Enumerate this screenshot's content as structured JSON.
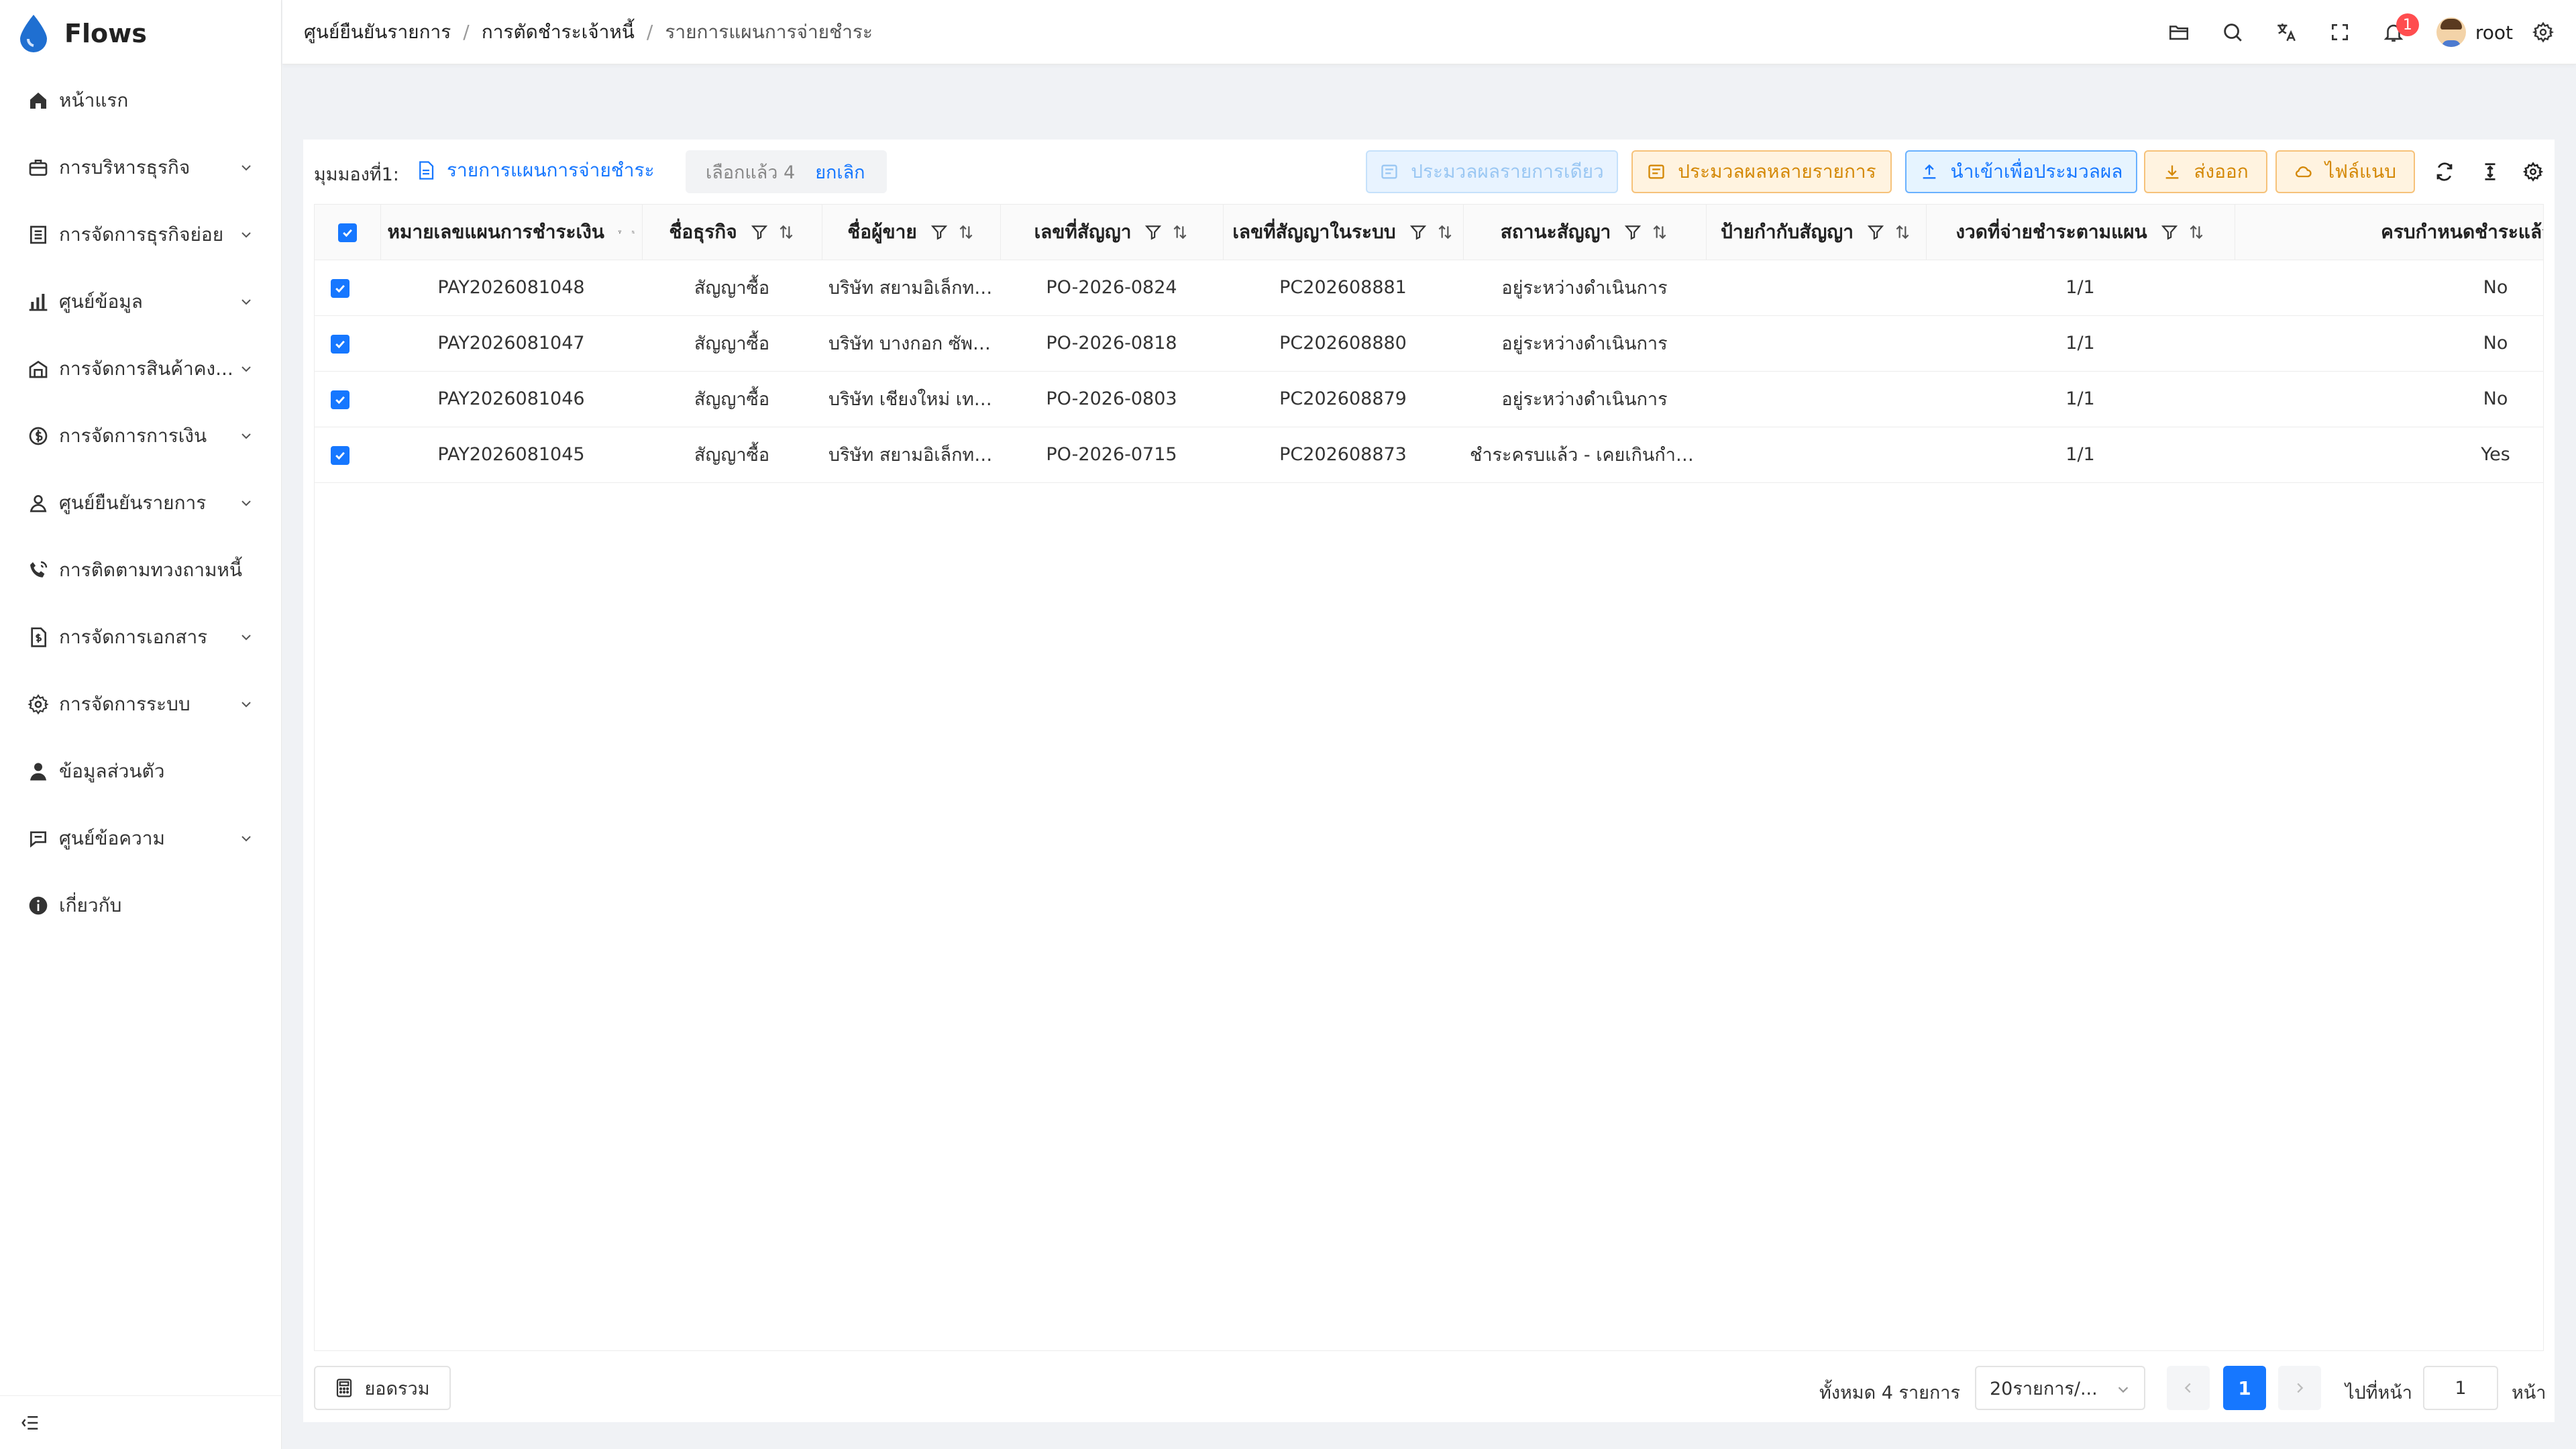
{
  "app": {
    "name": "Flows"
  },
  "sidebar": {
    "items": [
      {
        "label": "หน้าแรก",
        "icon": "home-icon",
        "has_children": false
      },
      {
        "label": "การบริหารธุรกิจ",
        "icon": "briefcase-icon",
        "has_children": true
      },
      {
        "label": "การจัดการธุรกิจย่อย",
        "icon": "building-icon",
        "has_children": true
      },
      {
        "label": "ศูนย์ข้อมูล",
        "icon": "bar-chart-icon",
        "has_children": true
      },
      {
        "label": "การจัดการสินค้าคง...",
        "icon": "warehouse-icon",
        "has_children": true
      },
      {
        "label": "การจัดการการเงิน",
        "icon": "dollar-circle-icon",
        "has_children": true
      },
      {
        "label": "ศูนย์ยืนยันรายการ",
        "icon": "user-check-icon",
        "has_children": true
      },
      {
        "label": "การติดตามทวงถามหนี้",
        "icon": "phone-call-icon",
        "has_children": false
      },
      {
        "label": "การจัดการเอกสาร",
        "icon": "document-dollar-icon",
        "has_children": true
      },
      {
        "label": "การจัดการระบบ",
        "icon": "gear-icon",
        "has_children": true
      },
      {
        "label": "ข้อมูลส่วนตัว",
        "icon": "person-icon",
        "has_children": false
      },
      {
        "label": "ศูนย์ข้อความ",
        "icon": "message-icon",
        "has_children": true
      },
      {
        "label": "เกี่ยวกับ",
        "icon": "info-icon",
        "has_children": false
      }
    ]
  },
  "header": {
    "breadcrumb": [
      "ศูนย์ยืนยันรายการ",
      "การตัดชำระเจ้าหนี้",
      "รายการแผนการจ่ายชำระ"
    ],
    "notification_count": "1",
    "username": "root"
  },
  "toolbar": {
    "view_label": "มุมมองที่1:",
    "view_name": "รายการแผนการจ่ายชำระ",
    "selected_text": "เลือกแล้ว 4",
    "cancel_label": "ยกเลิก",
    "btn_single": "ประมวลผลรายการเดียว",
    "btn_multi": "ประมวลผลหลายรายการ",
    "btn_import": "นำเข้าเพื่อประมวลผล",
    "btn_export": "ส่งออก",
    "btn_attach": "ไฟล์แนบ"
  },
  "table": {
    "columns": [
      "หมายเลขแผนการชำระเงิน",
      "ชื่อธุรกิจ",
      "ชื่อผู้ขาย",
      "เลขที่สัญญา",
      "เลขที่สัญญาในระบบ",
      "สถานะสัญญา",
      "ป้ายกำกับสัญญา",
      "งวดที่จ่ายชำระตามแผน",
      "ครบกำหนดชำระแล้ว"
    ],
    "rows": [
      [
        "PAY2026081048",
        "สัญญาซื้อ",
        "บริษัท สยามอิเล็กทรอนิกส์",
        "PO-2026-0824",
        "PC202608881",
        "อยู่ระหว่างดำเนินการ",
        "",
        "1/1",
        "No"
      ],
      [
        "PAY2026081047",
        "สัญญาซื้อ",
        "บริษัท บางกอก ซัพพลาย",
        "PO-2026-0818",
        "PC202608880",
        "อยู่ระหว่างดำเนินการ",
        "",
        "1/1",
        "No"
      ],
      [
        "PAY2026081046",
        "สัญญาซื้อ",
        "บริษัท เชียงใหม่ เทรดดิ้ง",
        "PO-2026-0803",
        "PC202608879",
        "อยู่ระหว่างดำเนินการ",
        "",
        "1/1",
        "No"
      ],
      [
        "PAY2026081045",
        "สัญญาซื้อ",
        "บริษัท สยามอิเล็กทรอนิกส์",
        "PO-2026-0715",
        "PC202608873",
        "ชำระครบแล้ว - เคยเกินกำหนด",
        "",
        "1/1",
        "Yes"
      ]
    ]
  },
  "footer": {
    "summary_label": "ยอดรวม",
    "total_text": "ทั้งหมด 4 รายการ",
    "page_size": "20รายการ/...",
    "current_page": "1",
    "goto_label": "ไปที่หน้า",
    "goto_value": "1",
    "goto_suffix": "หน้า"
  },
  "colors": {
    "primary": "#1677ff",
    "warning": "#d48806",
    "danger": "#ff4d4f"
  }
}
